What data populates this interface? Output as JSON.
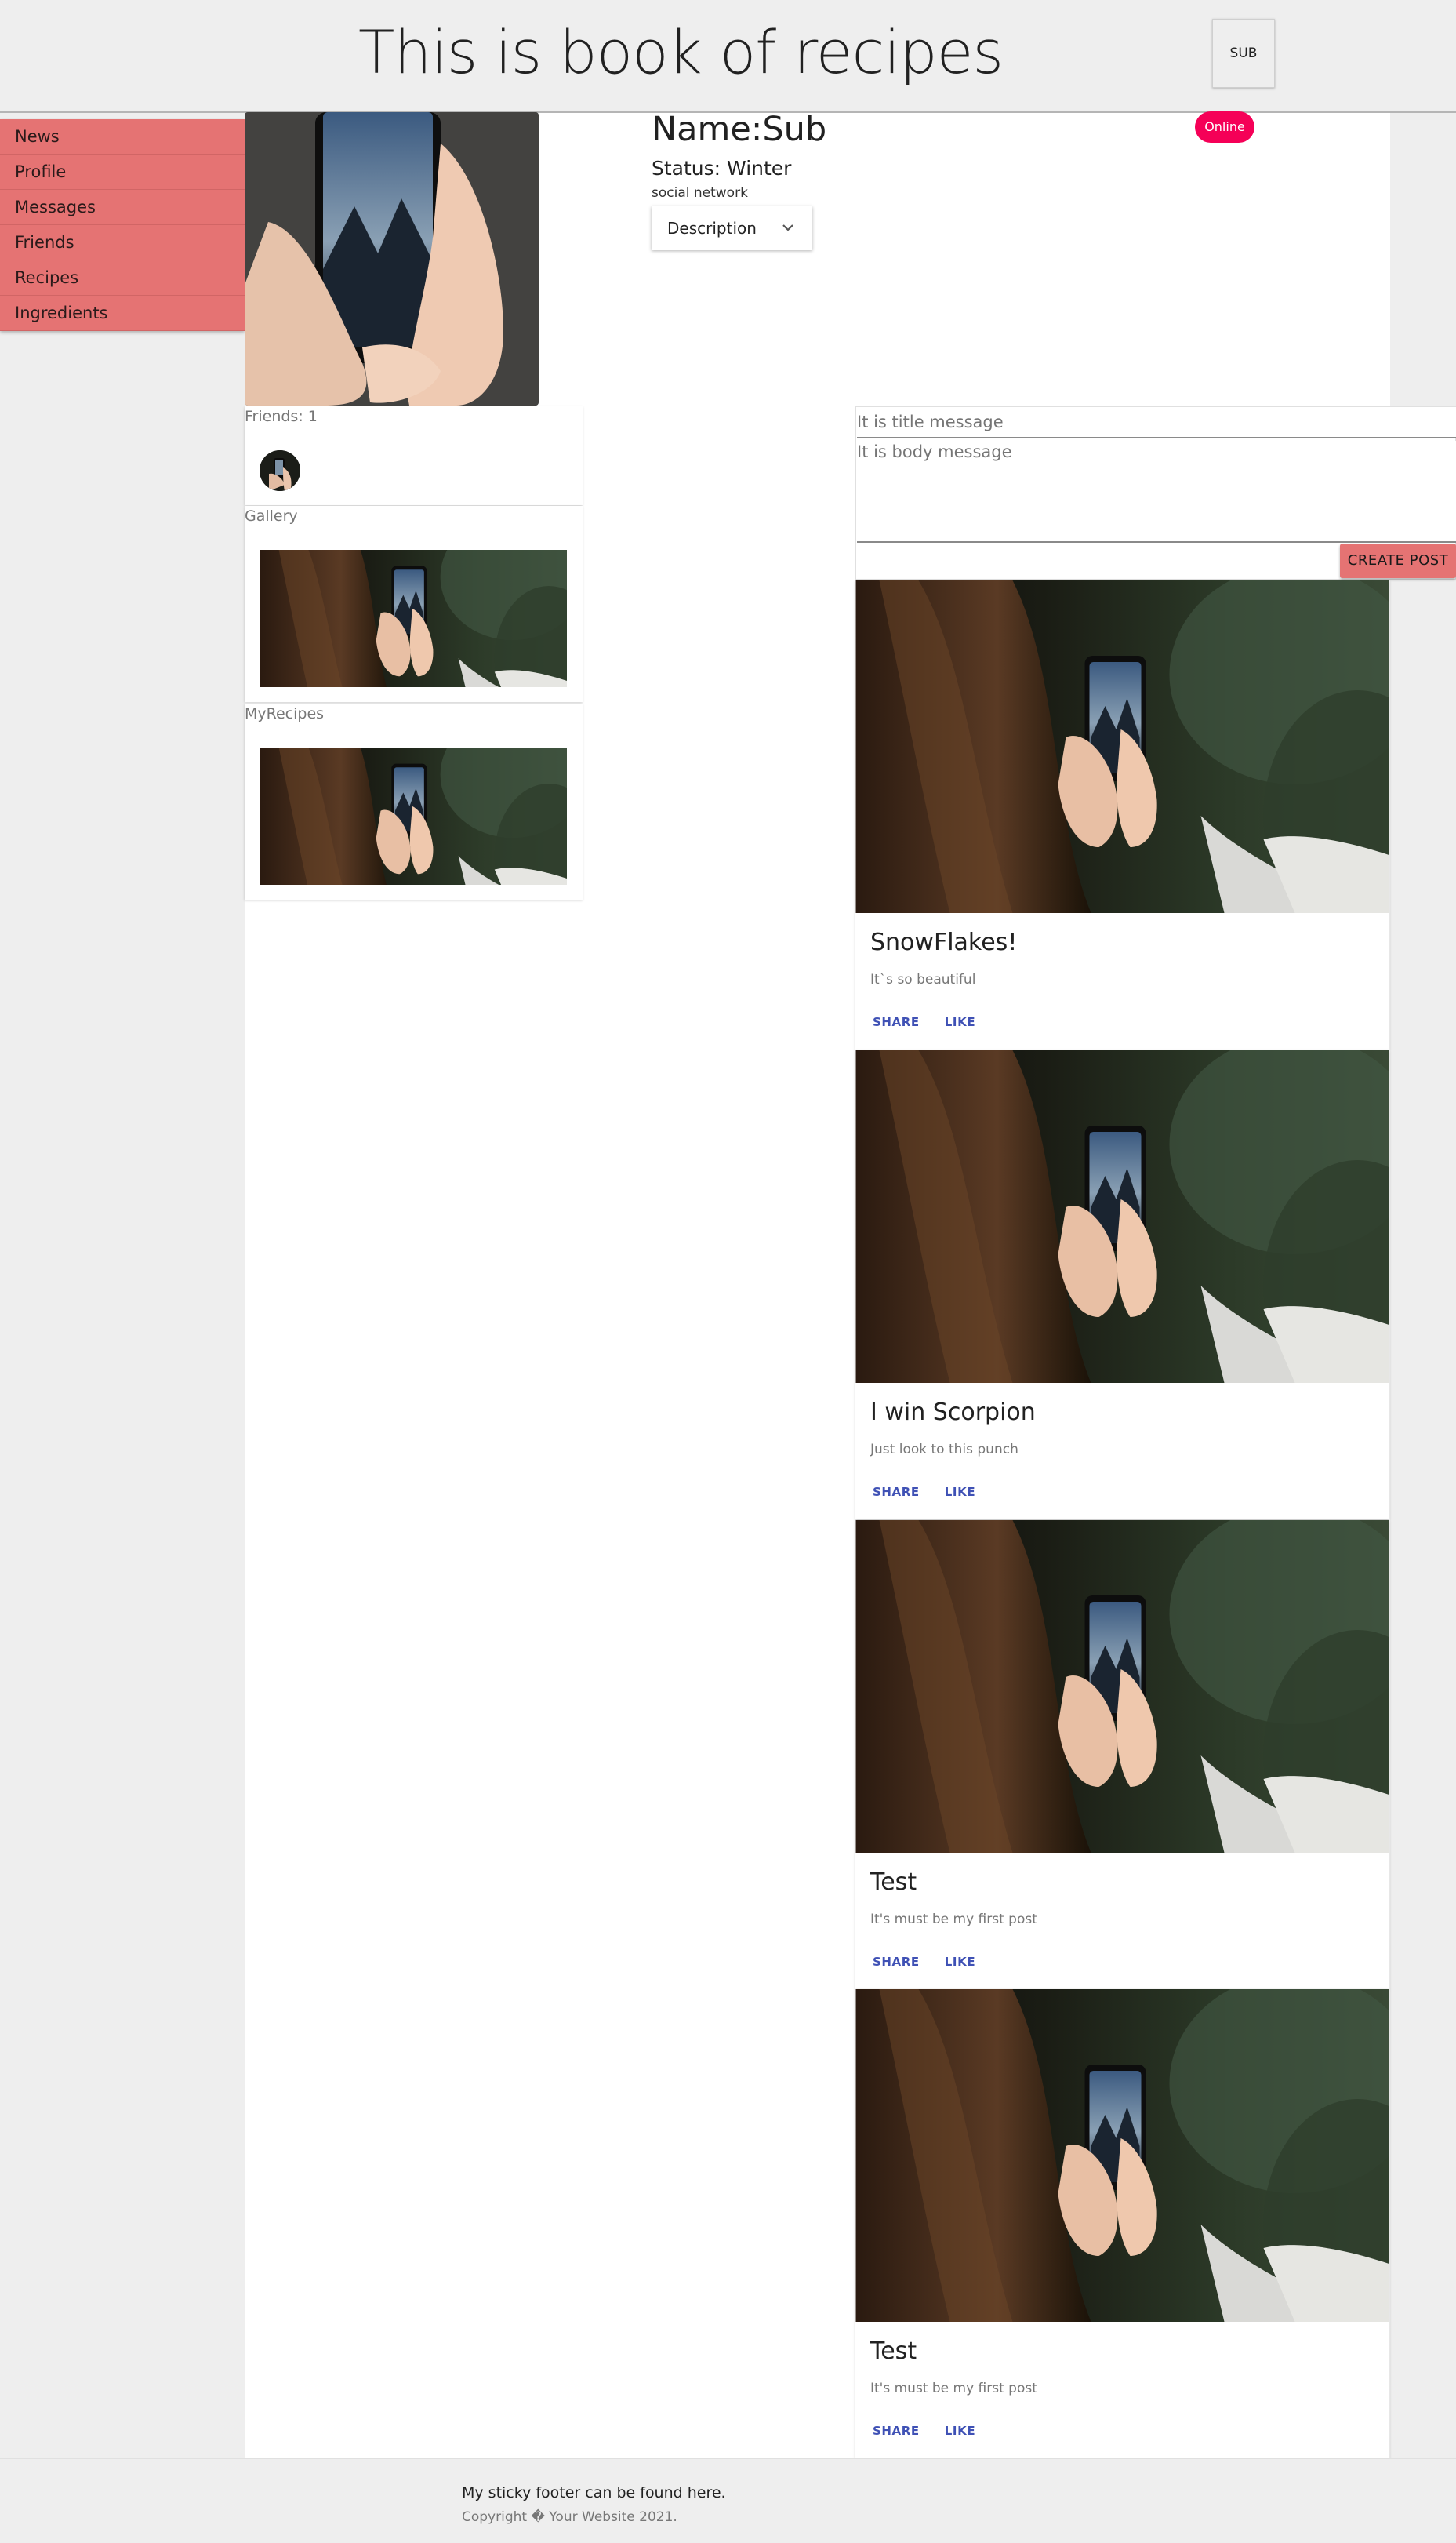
{
  "header": {
    "title": "This is book of recipes",
    "user_button": "SUB"
  },
  "sidebar": {
    "items": [
      {
        "label": "News"
      },
      {
        "label": "Profile"
      },
      {
        "label": "Messages"
      },
      {
        "label": "Friends"
      },
      {
        "label": "Recipes"
      },
      {
        "label": "Ingredients"
      }
    ]
  },
  "profile": {
    "name": "Name:Sub",
    "status": "Status: Winter",
    "network": "social network",
    "description_label": "Description",
    "online_badge": "Online"
  },
  "friends": {
    "label": "Friends: 1"
  },
  "gallery": {
    "label": "Gallery"
  },
  "my_recipes": {
    "label": "MyRecipes"
  },
  "post_form": {
    "title_placeholder": "It is title message",
    "body_placeholder": "It is body message",
    "submit_label": "CREATE POST"
  },
  "posts": [
    {
      "title": "SnowFlakes!",
      "body": "It`s so beautiful",
      "share": "SHARE",
      "like": "LIKE"
    },
    {
      "title": "I win Scorpion",
      "body": "Just look to this punch",
      "share": "SHARE",
      "like": "LIKE"
    },
    {
      "title": "Test",
      "body": "It's must be my first post",
      "share": "SHARE",
      "like": "LIKE"
    },
    {
      "title": "Test",
      "body": "It's must be my first post",
      "share": "SHARE",
      "like": "LIKE"
    }
  ],
  "footer": {
    "line1": "My sticky footer can be found here.",
    "line2": "Copyright � Your Website 2021."
  },
  "colors": {
    "sidebar_item": "#e57373",
    "online_badge": "#f50057",
    "action_text": "#3f51b5",
    "page_bg": "#eeeeee"
  }
}
